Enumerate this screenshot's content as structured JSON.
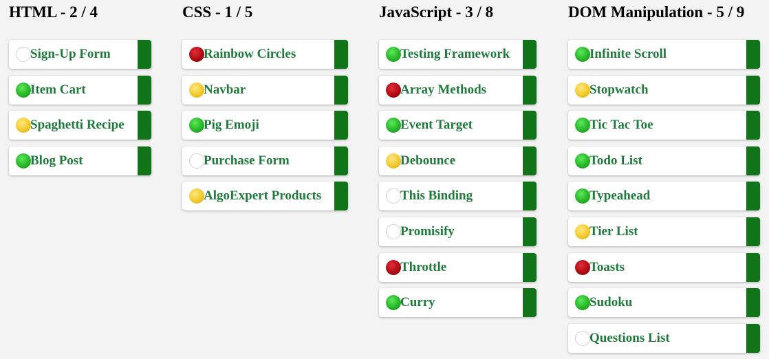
{
  "categories": [
    {
      "title": "HTML - 2 / 4",
      "questions": [
        {
          "name": "Sign-Up Form",
          "status": "not-attempted"
        },
        {
          "name": "Item Cart",
          "status": "complete"
        },
        {
          "name": "Spaghetti Recipe",
          "status": "in-progress"
        },
        {
          "name": "Blog Post",
          "status": "complete"
        }
      ]
    },
    {
      "title": "CSS - 1 / 5",
      "questions": [
        {
          "name": "Rainbow Circles",
          "status": "not-started"
        },
        {
          "name": "Navbar",
          "status": "in-progress"
        },
        {
          "name": "Pig Emoji",
          "status": "complete"
        },
        {
          "name": "Purchase Form",
          "status": "not-attempted"
        },
        {
          "name": "AlgoExpert Products",
          "status": "in-progress"
        }
      ]
    },
    {
      "title": "JavaScript - 3 / 8",
      "questions": [
        {
          "name": "Testing Framework",
          "status": "complete"
        },
        {
          "name": "Array Methods",
          "status": "not-started"
        },
        {
          "name": "Event Target",
          "status": "complete"
        },
        {
          "name": "Debounce",
          "status": "in-progress"
        },
        {
          "name": "This Binding",
          "status": "not-attempted"
        },
        {
          "name": "Promisify",
          "status": "not-attempted"
        },
        {
          "name": "Throttle",
          "status": "not-started"
        },
        {
          "name": "Curry",
          "status": "complete"
        }
      ]
    },
    {
      "title": "DOM Manipulation - 5 / 9",
      "questions": [
        {
          "name": "Infinite Scroll",
          "status": "complete"
        },
        {
          "name": "Stopwatch",
          "status": "in-progress"
        },
        {
          "name": "Tic Tac Toe",
          "status": "complete"
        },
        {
          "name": "Todo List",
          "status": "complete"
        },
        {
          "name": "Typeahead",
          "status": "complete"
        },
        {
          "name": "Tier List",
          "status": "in-progress"
        },
        {
          "name": "Toasts",
          "status": "not-started"
        },
        {
          "name": "Sudoku",
          "status": "complete"
        },
        {
          "name": "Questions List",
          "status": "not-attempted"
        }
      ]
    }
  ],
  "colors": {
    "complete": "#2fbf2f",
    "in-progress": "#f5cf3a",
    "not-started": "#b50d16",
    "not-attempted": "#ffffff",
    "question-text": "#1f7a3c",
    "bar": "#127419",
    "background": "#f2f3f2"
  }
}
